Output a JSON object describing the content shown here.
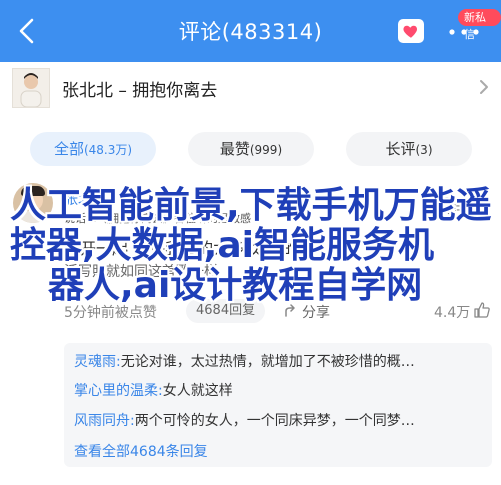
{
  "header": {
    "title": "评论(483314)",
    "badge": "新私信",
    "accent": "#3d8ff0"
  },
  "song": {
    "title": "张北北 – 拥抱你离去"
  },
  "tabs": [
    {
      "label": "全部",
      "count": "(48.3万)"
    },
    {
      "label": "最赞",
      "count": "(999)"
    },
    {
      "label": "长评",
      "count": "(3)"
    }
  ],
  "comment": {
    "author": "张北北",
    "follow_label": "关注",
    "line1": "说话…《拥抱你离去》各位听的是敏感",
    "line2": "离开一起 也许我要的太多 太多的生",
    "line3": "活写照就如同这首歌一样",
    "time": "5分钟前被点赞",
    "reply_count": "4684回复",
    "share_label": "分享",
    "likes": "4.4万"
  },
  "replies": [
    {
      "name": "灵魂雨:",
      "text": "无论对谁，太过热情，就增加了不被珍惜的概…"
    },
    {
      "name": "掌心里的温柔:",
      "text": "女人就这样"
    },
    {
      "name": "风雨同舟:",
      "text": "两个可怜的女人，一个同床异梦，一个同梦…"
    }
  ],
  "view_all": "查看全部4684条回复",
  "watermark": {
    "line1": "人工智能前景,下载手机万能遥",
    "line2": "控器,大数据,ai智能服务机",
    "line3": "器人,ai设计教程自学网"
  }
}
